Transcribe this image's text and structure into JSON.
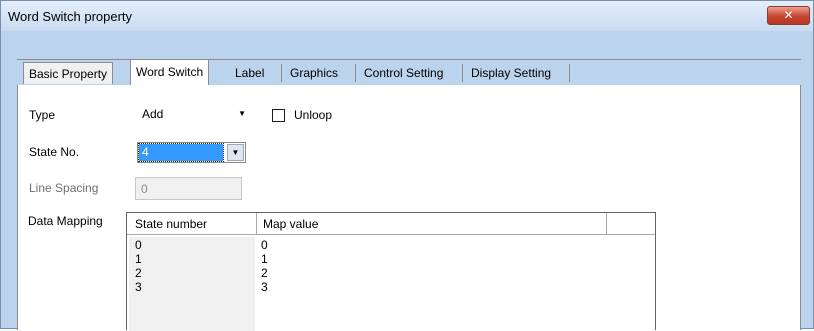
{
  "window": {
    "title": "Word Switch property",
    "close_glyph": "✕"
  },
  "tabs": [
    {
      "label": "Basic Property"
    },
    {
      "label": "Word Switch"
    },
    {
      "label": "Label"
    },
    {
      "label": "Graphics"
    },
    {
      "label": "Control Setting"
    },
    {
      "label": "Display Setting"
    }
  ],
  "active_tab": "Word Switch",
  "form": {
    "type_label": "Type",
    "type_value": "Add",
    "unloop_label": "Unloop",
    "unloop_checked": false,
    "state_no_label": "State No.",
    "state_no_value": "4",
    "line_spacing_label": "Line Spacing",
    "line_spacing_value": "0",
    "data_mapping_label": "Data Mapping"
  },
  "mapping_table": {
    "headers": [
      "State number",
      "Map value"
    ],
    "rows": [
      [
        "0",
        "0"
      ],
      [
        "1",
        "1"
      ],
      [
        "2",
        "2"
      ],
      [
        "3",
        "3"
      ]
    ]
  },
  "icons": {
    "dropdown": "chevron-down-icon",
    "close": "close-icon"
  }
}
